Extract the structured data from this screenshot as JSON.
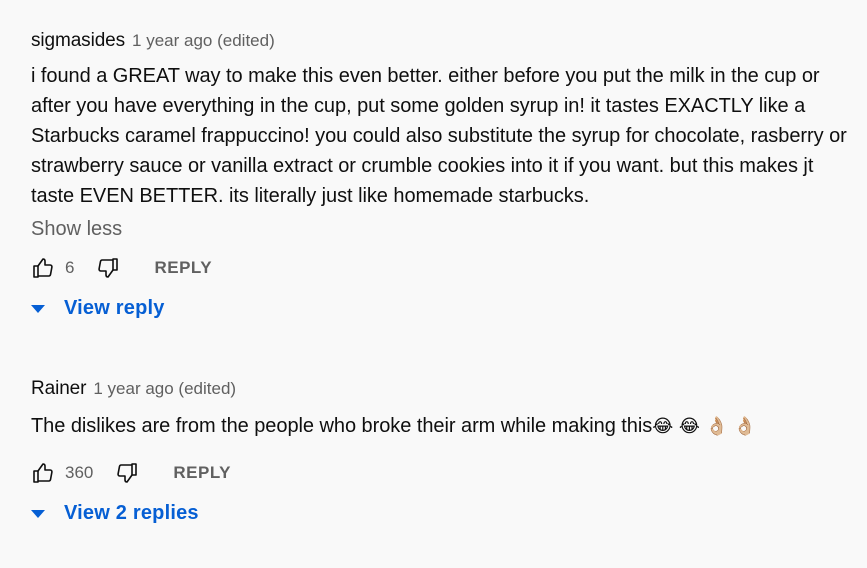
{
  "comments": [
    {
      "author": "sigmasides",
      "time": "1 year ago (edited)",
      "text": "i found a GREAT way to make this even better. either before you put the milk in the cup or after you have everything in the cup, put some golden syrup in! it tastes EXACTLY like a Starbucks caramel frappuccino! you could also substitute the syrup for chocolate, rasberry or strawberry sauce or vanilla extract or crumble cookies into it if you want. but this makes jt taste EVEN BETTER. its literally just like homemade starbucks.",
      "show_less": "Show less",
      "likes": "6",
      "reply_label": "REPLY",
      "replies_label": "View reply"
    },
    {
      "author": "Rainer",
      "time": "1 year ago (edited)",
      "text": "The dislikes are from the people who broke their arm while making this",
      "emojis": "😂 😂 👌🏼 👌🏼",
      "likes": "360",
      "reply_label": "REPLY",
      "replies_label": "View 2 replies"
    }
  ],
  "colors": {
    "link": "#065fd4",
    "secondary": "#606060",
    "background": "#f9f9f9"
  },
  "icons": [
    "like-icon",
    "dislike-icon",
    "caret-down-icon"
  ]
}
